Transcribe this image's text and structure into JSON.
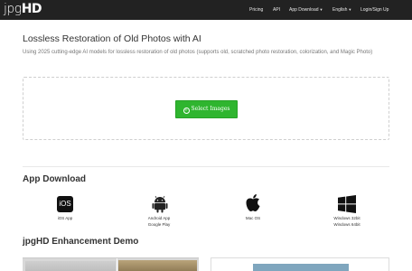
{
  "header": {
    "logo_part1": "jpg",
    "logo_part2": "HD",
    "nav": {
      "pricing": "Pricing",
      "api": "API",
      "app_download": "App Download",
      "language": "English",
      "login": "Login/Sign Up"
    }
  },
  "hero": {
    "title": "Lossless Restoration of Old Photos with AI",
    "description": "Using 2025 cutting-edge AI models for lossless restoration of old photos (supports old, scratched photo restoration, colorization, and Magic Photo)",
    "select_button": "Select Images"
  },
  "apps": {
    "heading": "App Download",
    "items": [
      {
        "icon": "ios-icon",
        "icon_text": "iOS",
        "lines": [
          "iOS App"
        ]
      },
      {
        "icon": "android-icon",
        "lines": [
          "Android App",
          "Google Play"
        ]
      },
      {
        "icon": "apple-icon",
        "lines": [
          "Mac OS"
        ]
      },
      {
        "icon": "windows-icon",
        "lines": [
          "Windows 32bit",
          "Windows 64bit"
        ]
      }
    ]
  },
  "demo": {
    "heading": "jpgHD Enhancement Demo"
  },
  "colors": {
    "navbar": "#222222",
    "button_green": "#2fb52f",
    "text": "#333333",
    "muted": "#777777"
  }
}
